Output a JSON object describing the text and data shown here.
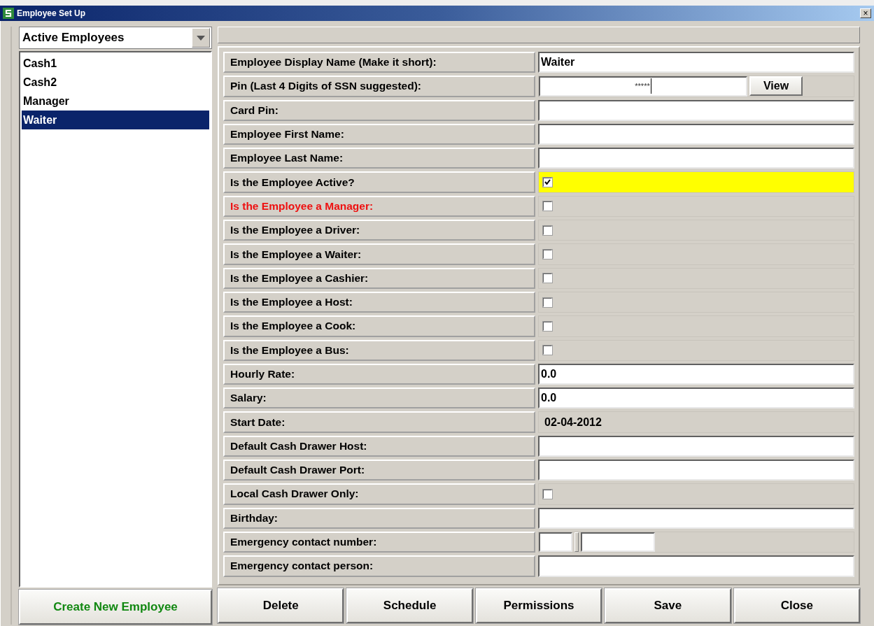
{
  "window": {
    "title": "Employee Set Up",
    "close": "×"
  },
  "filter": {
    "value": "Active Employees"
  },
  "employees": [
    {
      "name": "Cash1",
      "selected": false
    },
    {
      "name": "Cash2",
      "selected": false
    },
    {
      "name": "Manager",
      "selected": false
    },
    {
      "name": "Waiter",
      "selected": true
    }
  ],
  "create_button": "Create New Employee",
  "fields": [
    {
      "kind": "text",
      "label": "Employee Display Name (Make it short):",
      "value": "Waiter",
      "emphasis": false
    },
    {
      "kind": "password",
      "label": "Pin (Last 4 Digits of SSN suggested):",
      "value": "*****",
      "button": "View",
      "emphasis": false
    },
    {
      "kind": "text",
      "label": "Card Pin:",
      "emphasis": false
    },
    {
      "kind": "text",
      "label": "Employee First Name:",
      "emphasis": false
    },
    {
      "kind": "text",
      "label": "Employee Last Name:",
      "emphasis": false
    },
    {
      "kind": "checkbox",
      "label": "Is the Employee Active?",
      "checked": true,
      "emphasis": false,
      "highlighted": true
    },
    {
      "kind": "checkbox",
      "label": "Is the Employee a Manager:",
      "checked": false,
      "emphasis": true,
      "highlighted": false
    },
    {
      "kind": "checkbox",
      "label": "Is the Employee a Driver:",
      "checked": false,
      "emphasis": false,
      "highlighted": false
    },
    {
      "kind": "checkbox",
      "label": "Is the Employee a Waiter:",
      "checked": false,
      "emphasis": false,
      "highlighted": false
    },
    {
      "kind": "checkbox",
      "label": "Is the Employee a Cashier:",
      "checked": false,
      "emphasis": false,
      "highlighted": false
    },
    {
      "kind": "checkbox",
      "label": "Is the Employee a Host:",
      "checked": false,
      "emphasis": false,
      "highlighted": false
    },
    {
      "kind": "checkbox",
      "label": "Is the Employee a Cook:",
      "checked": false,
      "emphasis": false,
      "highlighted": false
    },
    {
      "kind": "checkbox",
      "label": "Is the Employee a Bus:",
      "checked": false,
      "emphasis": false,
      "highlighted": false
    },
    {
      "kind": "text",
      "label": "Hourly Rate:",
      "value": "0.0",
      "emphasis": false
    },
    {
      "kind": "text",
      "label": "Salary:",
      "value": "0.0",
      "emphasis": false
    },
    {
      "kind": "static",
      "label": "Start Date:",
      "value": "02-04-2012",
      "emphasis": false
    },
    {
      "kind": "text",
      "label": "Default Cash Drawer Host:",
      "emphasis": false
    },
    {
      "kind": "text",
      "label": "Default Cash Drawer Port:",
      "emphasis": false
    },
    {
      "kind": "checkbox",
      "label": "Local Cash Drawer Only:",
      "checked": false,
      "emphasis": false,
      "highlighted": false
    },
    {
      "kind": "text",
      "label": "Birthday:",
      "emphasis": false
    },
    {
      "kind": "phone",
      "label": "Emergency contact number:",
      "emphasis": false
    },
    {
      "kind": "text",
      "label": "Emergency contact person:",
      "emphasis": false
    }
  ],
  "actions": [
    "Delete",
    "Schedule",
    "Permissions",
    "Save",
    "Close"
  ]
}
